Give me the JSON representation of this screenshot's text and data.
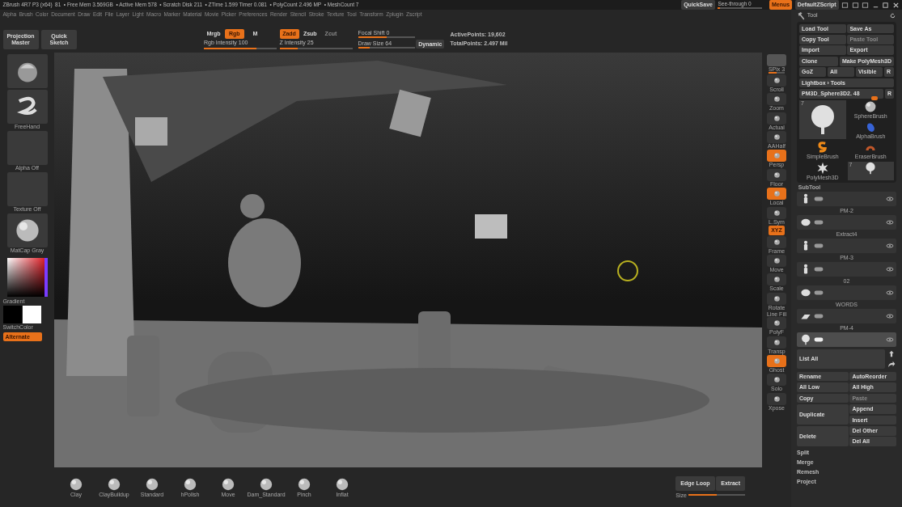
{
  "title_bar": {
    "app": "ZBrush 4R7 P3 (x64)",
    "code": "81",
    "stats": [
      "• Free Mem 3.569GB",
      "• Active Mem 578",
      "• Scratch Disk 211",
      "• ZTime 1.599 Timer 0.081",
      "• PolyCount 2.496 MP",
      "• MeshCount 7"
    ],
    "controls": [
      {
        "kind": "button",
        "label": "QuickSave"
      },
      {
        "kind": "slider",
        "label": "See-through",
        "reading": "0",
        "level": 0.05
      },
      {
        "kind": "toggle",
        "label": "Menus",
        "on": true
      },
      {
        "kind": "button",
        "label": "DefaultZScript"
      }
    ]
  },
  "menus": [
    "Alpha",
    "Brush",
    "Color",
    "Document",
    "Draw",
    "Edit",
    "File",
    "Layer",
    "Light",
    "Macro",
    "Marker",
    "Material",
    "Movie",
    "Picker",
    "Preferences",
    "Render",
    "Stencil",
    "Stroke",
    "Texture",
    "Tool",
    "Transform",
    "Zplugin",
    "Zscript"
  ],
  "shelf": {
    "buttons": [
      "Projection Master",
      "Quick Sketch"
    ],
    "mode_groups": [
      {
        "modes": [
          {
            "label": "Mrgb",
            "on": false,
            "disabled": false
          },
          {
            "label": "Rgb",
            "on": true,
            "disabled": false
          },
          {
            "label": "M",
            "on": false,
            "disabled": false
          }
        ],
        "slider": {
          "label": "Rgb Intensity",
          "reading": "100",
          "level": 0.72
        }
      },
      {
        "modes": [
          {
            "label": "Zadd",
            "on": true,
            "disabled": false
          },
          {
            "label": "Zsub",
            "on": false,
            "disabled": false
          },
          {
            "label": "Zcut",
            "on": false,
            "disabled": true
          }
        ],
        "slider": {
          "label": "Z Intensity",
          "reading": "25",
          "level": 0.25
        }
      }
    ],
    "sliders": [
      {
        "label": "Focal Shift",
        "reading": "0",
        "level": 0.5
      },
      {
        "label": "Draw Size",
        "reading": "64",
        "level": 0.2
      }
    ],
    "dynamic": "Dynamic",
    "points": [
      "ActivePoints: 19,602",
      "TotalPoints: 2.497 Mil"
    ]
  },
  "left_shelf": {
    "slots": [
      {
        "kind": "brush"
      },
      {
        "kind": "stroke",
        "label": "FreeHand"
      },
      {
        "kind": "empty",
        "label": "Alpha Off"
      },
      {
        "kind": "empty",
        "label": "Texture Off"
      },
      {
        "kind": "sphere",
        "label": "MatCap Gray"
      }
    ],
    "gradient_label": "Gradient",
    "switch_label": "SwitchColor",
    "alternate": {
      "label": "Alternate",
      "on": true
    }
  },
  "right_shelf": [
    {
      "label": "SPix 3",
      "kind": "slider",
      "level": 0.5
    },
    {
      "label": "Scroll",
      "kind": "icon",
      "on": false
    },
    {
      "label": "Zoom",
      "kind": "icon",
      "on": false
    },
    {
      "label": "Actual",
      "kind": "icon",
      "on": false
    },
    {
      "label": "AAHalf",
      "kind": "icon",
      "on": false
    },
    {
      "label": "Persp",
      "kind": "icon",
      "on": true
    },
    {
      "label": "Floor",
      "kind": "icon",
      "on": false
    },
    {
      "label": "Local",
      "kind": "icon",
      "on": true
    },
    {
      "label": "L.Sym",
      "kind": "icon",
      "on": false
    },
    {
      "label": "XYZ",
      "kind": "pill",
      "on": true
    },
    {
      "label": "Frame",
      "kind": "icon",
      "on": false
    },
    {
      "label": "Move",
      "kind": "icon",
      "on": false
    },
    {
      "label": "Scale",
      "kind": "icon",
      "on": false
    },
    {
      "label": "Rotate",
      "kind": "icon",
      "on": false
    },
    {
      "label": "PolyF",
      "caption": "Line Fill",
      "kind": "icon",
      "on": false
    },
    {
      "label": "Transp",
      "kind": "icon",
      "on": false
    },
    {
      "label": "Ghost",
      "kind": "icon",
      "on": true
    },
    {
      "label": "Solo",
      "kind": "icon",
      "on": false
    },
    {
      "label": "Xpose",
      "kind": "icon",
      "on": false
    }
  ],
  "tool_panel": {
    "title": "Tool",
    "rows": [
      [
        {
          "label": "Load Tool",
          "disabled": false
        },
        {
          "label": "Save As",
          "disabled": false
        }
      ],
      [
        {
          "label": "Copy Tool",
          "disabled": false
        },
        {
          "label": "Paste Tool",
          "disabled": true
        }
      ],
      [
        {
          "label": "Import",
          "disabled": false
        },
        {
          "label": "Export",
          "disabled": false
        }
      ],
      [
        {
          "label": "Clone",
          "disabled": false
        },
        {
          "label": "Make PolyMesh3D",
          "disabled": false
        }
      ],
      [
        {
          "label": "GoZ",
          "disabled": false
        },
        {
          "label": "All",
          "disabled": false
        },
        {
          "label": "Visible",
          "disabled": false
        },
        {
          "label": "R",
          "disabled": false
        }
      ],
      [
        {
          "label": "Lightbox › Tools",
          "disabled": false
        }
      ]
    ],
    "current": {
      "label": "PM3D_Sphere3D2. 48",
      "level": 0.85,
      "reset": "R"
    },
    "tools": [
      {
        "kind": "tree",
        "count": "7"
      },
      {
        "kind": "sphere",
        "label": "SphereBrush"
      },
      {
        "kind": "alpha",
        "label": "AlphaBrush"
      },
      {
        "kind": "s",
        "label": "SimpleBrush"
      },
      {
        "kind": "eraser",
        "label": "EraserBrush"
      },
      {
        "kind": "star",
        "label": "PolyMesh3D"
      },
      {
        "kind": "tree",
        "count": "7"
      }
    ],
    "subtool": {
      "title": "SubTool",
      "items": [
        {
          "kind": "figure",
          "selected": false
        },
        {
          "name": "PM-2",
          "kind": "blob",
          "selected": false
        },
        {
          "name": "Extract4",
          "kind": "figure",
          "selected": false
        },
        {
          "name": "PM-3",
          "kind": "figure",
          "selected": false
        },
        {
          "name": "02",
          "kind": "blob",
          "selected": false
        },
        {
          "name": "WORDS",
          "kind": "plane",
          "selected": false
        },
        {
          "name": "PM-4",
          "kind": "tree",
          "selected": true
        }
      ]
    },
    "list_all": "List All",
    "actions": [
      {
        "left": {
          "label": "Rename",
          "disabled": false
        },
        "right": [
          {
            "label": "AutoReorder",
            "disabled": false
          }
        ]
      },
      {
        "left": {
          "label": "All Low",
          "disabled": false
        },
        "right": [
          {
            "label": "All High",
            "disabled": false
          }
        ]
      },
      {
        "left": {
          "label": "Copy",
          "disabled": false
        },
        "right": [
          {
            "label": "Paste",
            "disabled": true
          }
        ]
      },
      {
        "left": {
          "label": "Duplicate",
          "disabled": false
        },
        "right": [
          {
            "label": "Append",
            "disabled": false
          },
          {
            "label": "Insert",
            "disabled": false
          }
        ]
      },
      {
        "left": {
          "label": "Delete",
          "disabled": false
        },
        "right": [
          {
            "label": "Del Other",
            "disabled": false
          },
          {
            "label": "Del All",
            "disabled": false
          }
        ]
      }
    ],
    "menu_items": [
      "Split",
      "Merge",
      "Remesh",
      "Project"
    ]
  },
  "tray": {
    "brushes": [
      "Clay",
      "ClayBuildup",
      "Standard",
      "hPolish",
      "Move",
      "Dam_Standard",
      "Pinch",
      "Inflat"
    ],
    "buttons": [
      "Edge Loop",
      "Extract"
    ],
    "size": {
      "label": "Size",
      "level": 0.5
    }
  }
}
